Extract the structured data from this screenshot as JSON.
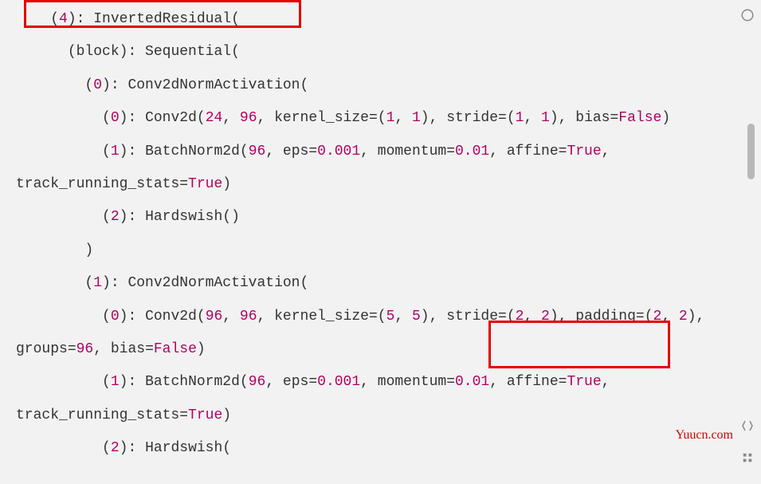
{
  "code": {
    "l1_idx": "4",
    "l1_class": "InvertedResidual",
    "l2_block": "block",
    "l2_seq": "Sequential",
    "l3_idx": "0",
    "l3_class": "Conv2dNormActivation",
    "l4_idx": "0",
    "l4_op": "Conv2d",
    "l4_in": "24",
    "l4_out": "96",
    "l4_ks": "kernel_size",
    "l4_ks1": "1",
    "l4_ks2": "1",
    "l4_st": "stride",
    "l4_st1": "1",
    "l4_st2": "1",
    "l5_bias": "bias",
    "l5_false": "False",
    "l6_idx": "1",
    "l6_op": "BatchNorm2d",
    "l6_n": "96",
    "l6_eps": "eps",
    "l6_epsv": "0.001",
    "l6_mom": "momentum",
    "l6_momv": "0.01",
    "l6_aff": "affine",
    "l6_true": "True",
    "l7_trs": "track_running_stats",
    "l7_true": "True",
    "l8_idx": "2",
    "l8_op": "Hardswish",
    "l9_close": ")",
    "l10_idx": "1",
    "l10_class": "Conv2dNormActivation",
    "l11_idx": "0",
    "l11_op": "Conv2d",
    "l11_in": "96",
    "l11_out": "96",
    "l11_ks": "kernel_size",
    "l11_ks1": "5",
    "l11_ks2": "5",
    "l11_st": "stride",
    "l11_st1": "2",
    "l11_st2": "2",
    "l12_pad": "padding",
    "l12_p1": "2",
    "l12_p2": "2",
    "l12_grp": "groups",
    "l12_grpv": "96",
    "l12_bias": "bias",
    "l12_false": "False",
    "l13_idx": "1",
    "l13_op": "BatchNorm2d",
    "l13_n": "96",
    "l13_eps": "eps",
    "l13_epsv": "0.001",
    "l13_mom": "momentum",
    "l13_momv": "0.01",
    "l13_aff": "affine",
    "l13_true": "True",
    "l14_trs": "track_running_stats",
    "l14_true": "True",
    "l15_idx": "2",
    "l15_op": "Hardswish"
  },
  "watermark": "Yuucn.com"
}
